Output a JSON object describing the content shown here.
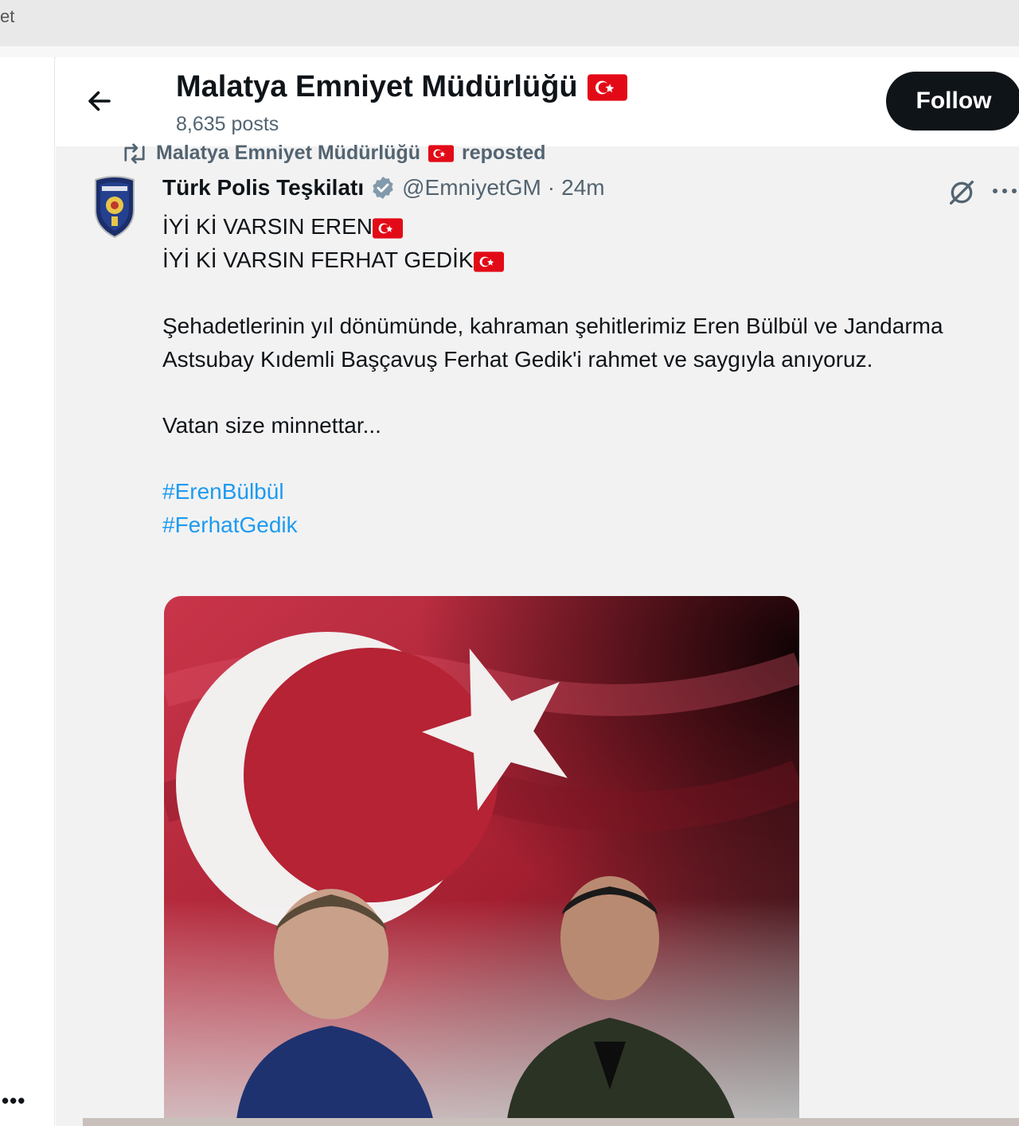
{
  "browser": {
    "tab_fragment": "et"
  },
  "header": {
    "back_icon": "arrow-left-icon",
    "title": "Malatya Emniyet Müdürlüğü",
    "posts_count": "8,635 posts",
    "follow_label": "Follow"
  },
  "repost": {
    "icon": "repost-icon",
    "account": "Malatya Emniyet Müdürlüğü",
    "label": "reposted"
  },
  "tweet": {
    "author_name": "Türk Polis Teşkilatı",
    "verified_icon": "verified-badge-icon",
    "handle": "@EmniyetGM",
    "separator": "·",
    "time": "24m",
    "line1": "İYİ Kİ VARSIN EREN",
    "line2": "İYİ Kİ VARSIN FERHAT GEDİK",
    "paragraph": "Şehadetlerinin yıl dönümünde, kahraman şehitlerimiz Eren Bülbül ve Jandarma Astsubay Kıdemli Başçavuş Ferhat Gedik'i rahmet ve saygıyla anıyoruz.",
    "closing": "Vatan size minnettar...",
    "hashtags": [
      "#ErenBülbül",
      "#FerhatGedik"
    ]
  },
  "left_nav": {
    "more_label": "•••"
  },
  "colors": {
    "accent": "#1d9bf0",
    "flag_red": "#e30a17",
    "text": "#0f1419",
    "muted": "#536471"
  }
}
